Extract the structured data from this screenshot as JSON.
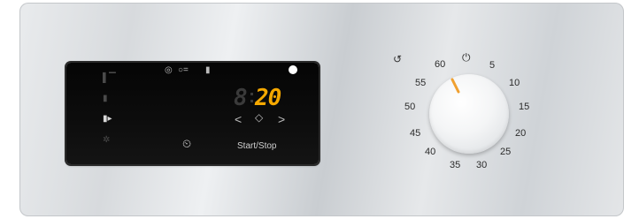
{
  "display": {
    "icons": {
      "left_top": "oven-top-heat-icon",
      "left_mid": "thermometer-icon",
      "left_mid2": "probe-icon",
      "left_bottom": "snowflake-icon",
      "top_row": [
        "fan-icon",
        "key-lock-icon",
        "probe-small-icon"
      ],
      "timer_icon": "timer-icon"
    },
    "time_dim_digit": "8",
    "time_value": "20",
    "nav_left": "<",
    "nav_center": "◇",
    "nav_right": ">",
    "start_stop_label": "Start/Stop"
  },
  "dial": {
    "icon_left": "timer-return-icon",
    "power_icon": "power-icon",
    "marks": [
      "60",
      "5",
      "10",
      "15",
      "20",
      "25",
      "30",
      "35",
      "40",
      "45",
      "50",
      "55"
    ],
    "selected_value": 55
  },
  "colors": {
    "display_digit": "#f5a800",
    "dial_pointer": "#f0a030"
  }
}
